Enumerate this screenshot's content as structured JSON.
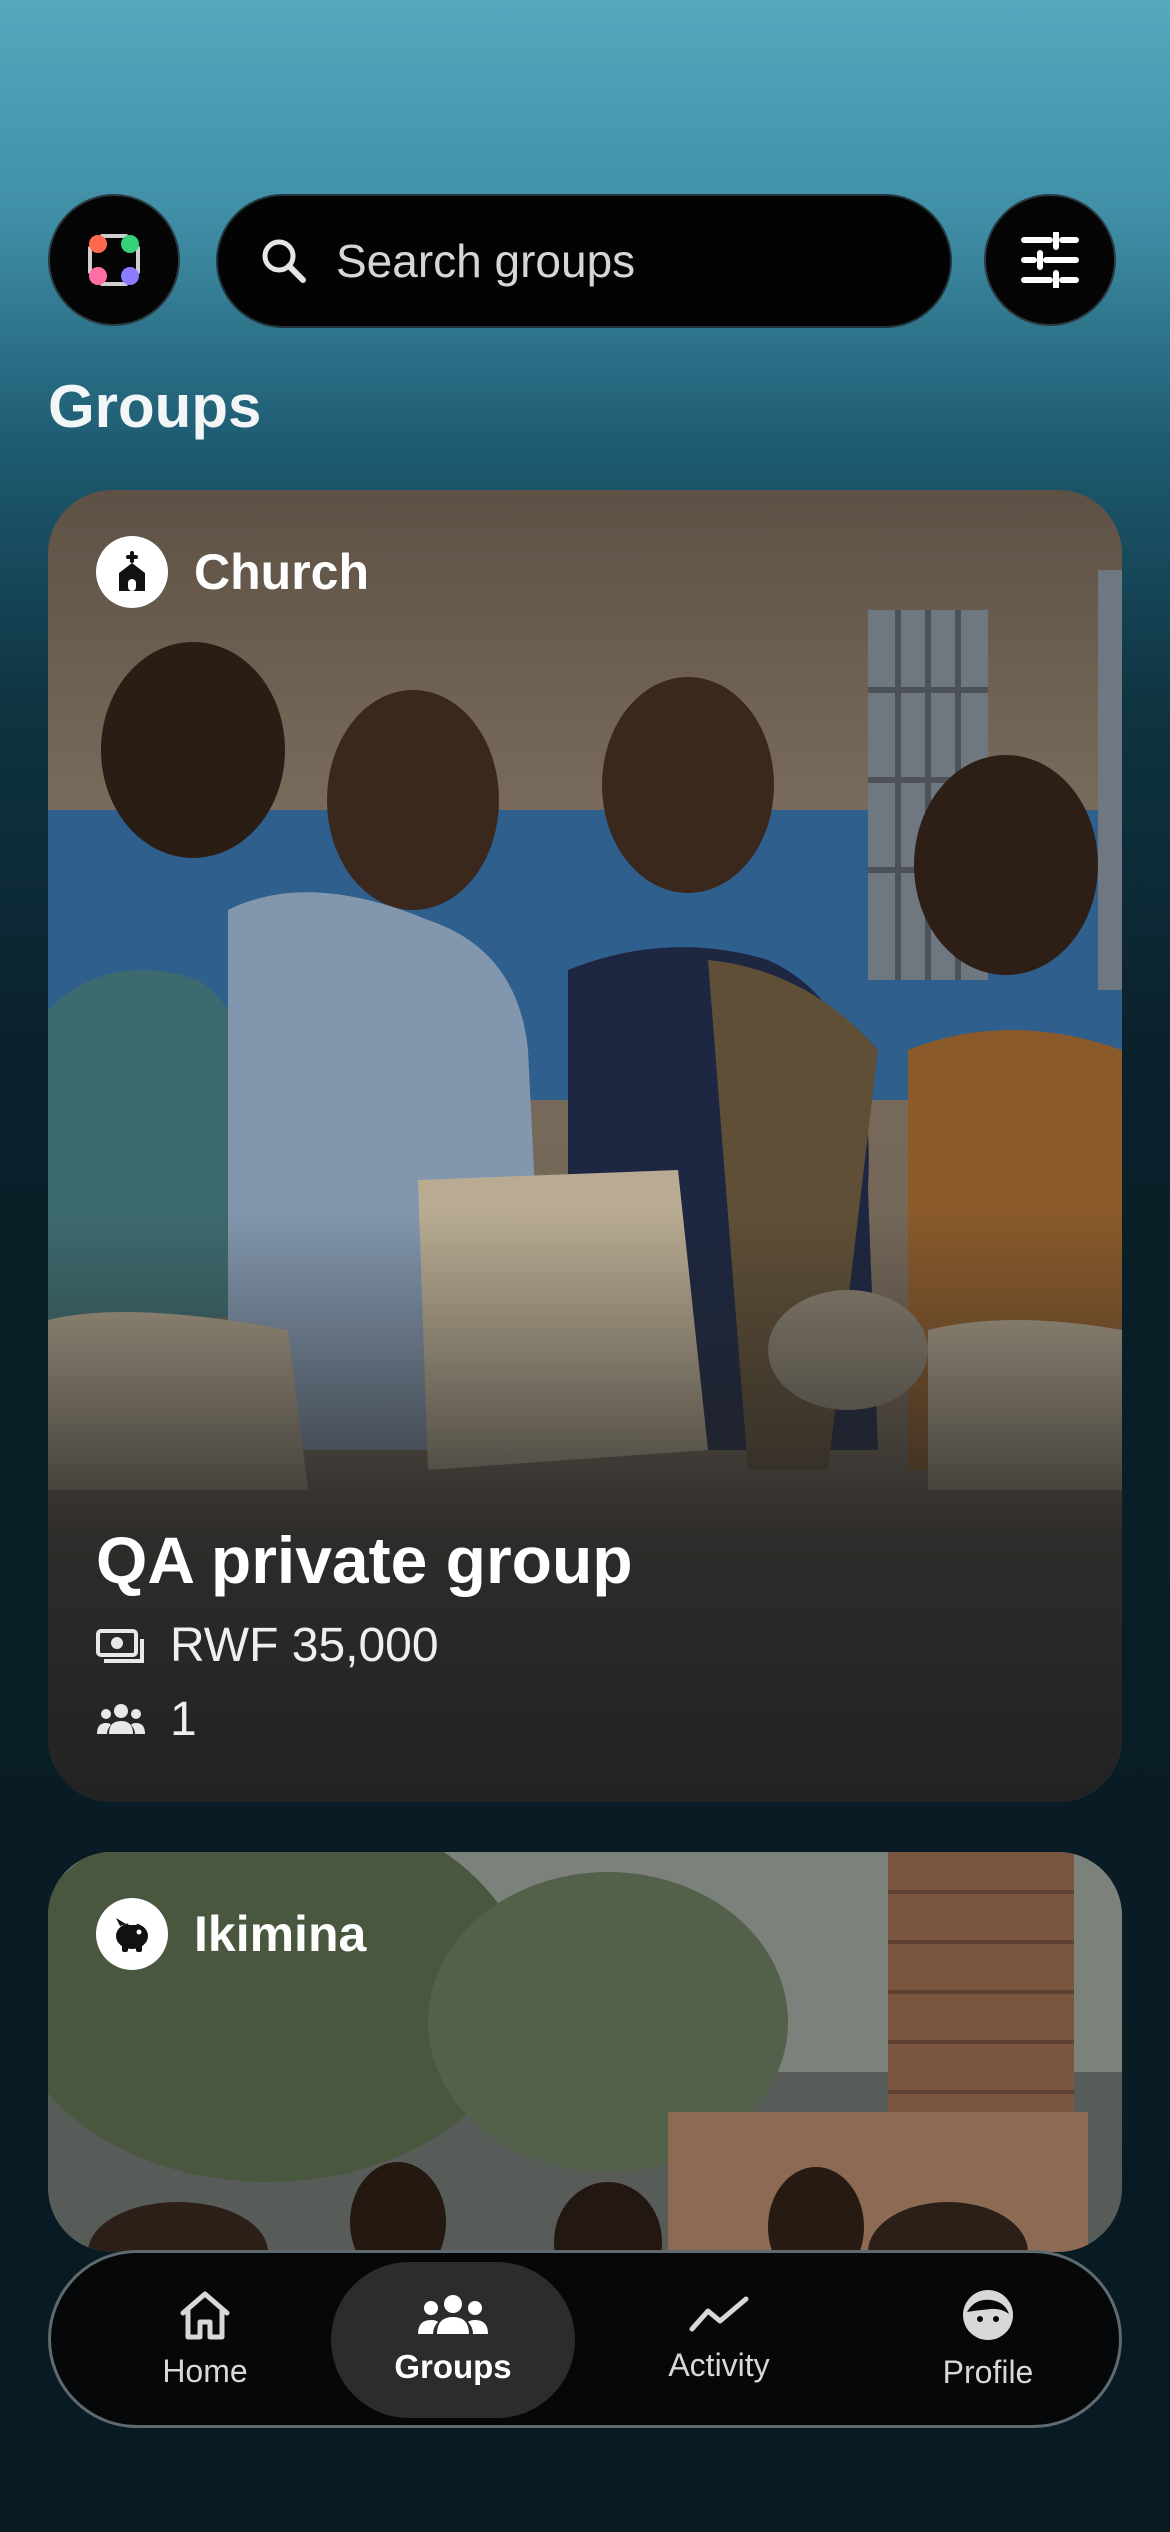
{
  "search": {
    "placeholder": "Search groups"
  },
  "section_title": "Groups",
  "groups": [
    {
      "category": "Church",
      "name": "QA private group",
      "amount": "RWF 35,000",
      "members": "1"
    },
    {
      "category": "Ikimina"
    }
  ],
  "nav": {
    "home": "Home",
    "groups": "Groups",
    "activity": "Activity",
    "profile": "Profile"
  },
  "icons": {
    "logo": "app-logo-icon",
    "search": "search-icon",
    "filter": "filter-sliders-icon",
    "church": "church-icon",
    "ikimina": "piggy-bank-icon",
    "money": "money-icon",
    "members": "people-icon"
  },
  "colors": {
    "logo_dots": [
      "#ff6a4d",
      "#35d17a",
      "#8a7bff",
      "#ff6fa5"
    ]
  }
}
